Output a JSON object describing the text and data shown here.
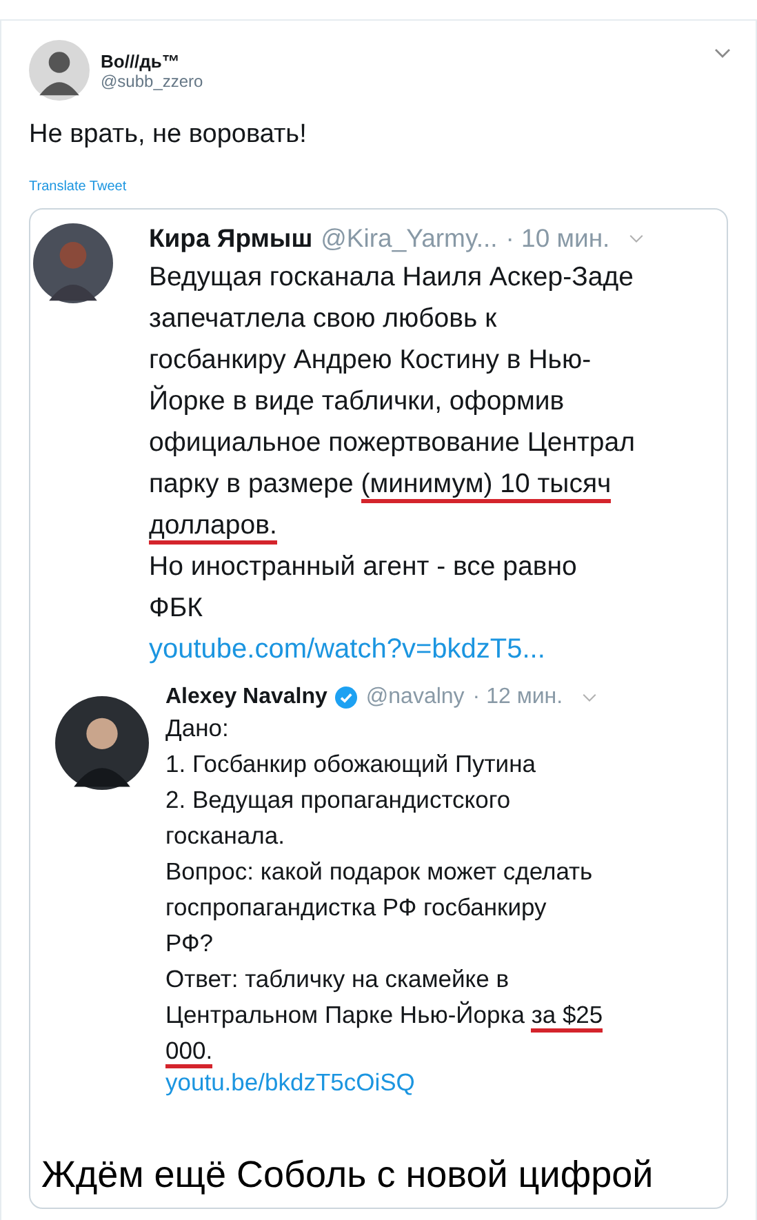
{
  "tweet": {
    "author": {
      "name": "Во///дь™",
      "handle": "@subb_zzero"
    },
    "text": "Не врать, не воровать!",
    "translate": "Translate Tweet",
    "image": {
      "quoted": [
        {
          "name": "Кира Ярмыш",
          "verified": false,
          "handle": "@Kira_Yarmy...",
          "time": "· 10 мин.",
          "lines": [
            [
              {
                "text": "Ведущая госканала Наиля Аскер-Заде",
                "marked": false
              }
            ],
            [
              {
                "text": "запечатлела свою любовь к",
                "marked": false
              }
            ],
            [
              {
                "text": "госбанкиру Андрею Костину в Нью-",
                "marked": false
              }
            ],
            [
              {
                "text": "Йорке в виде таблички, оформив",
                "marked": false
              }
            ],
            [
              {
                "text": "официальное пожертвование Централ",
                "marked": false
              }
            ],
            [
              {
                "text": "парку в размере ",
                "marked": false
              },
              {
                "text": "(минимум) 10 тысяч",
                "marked": true
              }
            ],
            [
              {
                "text": "долларов.",
                "marked": true
              }
            ],
            [
              {
                "text": "Но иностранный агент - все равно",
                "marked": false
              }
            ],
            [
              {
                "text": "ФБК",
                "marked": false
              }
            ]
          ],
          "link": "youtube.com/watch?v=bkdzT5..."
        },
        {
          "name": "Alexey Navalny",
          "verified": true,
          "handle": "@navalny",
          "time": "· 12 мин.",
          "lines": [
            [
              {
                "text": "Дано:",
                "marked": false
              }
            ],
            [
              {
                "text": "1. Госбанкир обожающий Путина",
                "marked": false
              }
            ],
            [
              {
                "text": "2. Ведущая пропагандистского",
                "marked": false
              }
            ],
            [
              {
                "text": "госканала.",
                "marked": false
              }
            ],
            [
              {
                "text": "Вопрос: какой подарок может сделать",
                "marked": false
              }
            ],
            [
              {
                "text": "госпропагандистка РФ госбанкиру",
                "marked": false
              }
            ],
            [
              {
                "text": "РФ?",
                "marked": false
              }
            ],
            [
              {
                "text": "Ответ: табличку на скамейке в",
                "marked": false
              }
            ],
            [
              {
                "text": "Центральном Парке Нью-Йорка ",
                "marked": false
              },
              {
                "text": "за $25",
                "marked": true
              }
            ],
            [
              {
                "text": "000.",
                "marked": true
              }
            ]
          ],
          "link": "youtu.be/bkdzT5cOiSQ"
        }
      ],
      "caption": "Ждём ещё Соболь с новой цифрой"
    }
  }
}
